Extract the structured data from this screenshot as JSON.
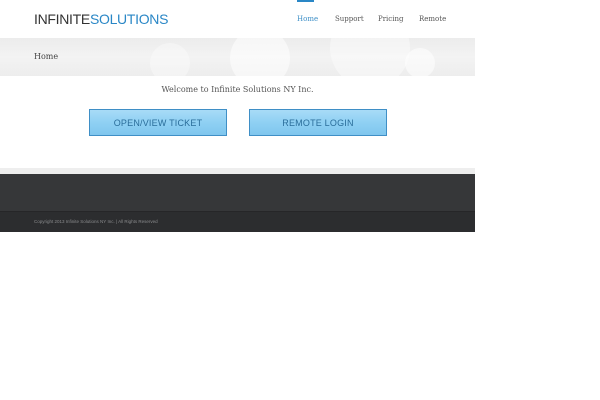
{
  "header": {
    "logo_part1": "INFINITE",
    "logo_part2": "SOLUTIONS",
    "nav": [
      {
        "label": "Home",
        "active": true
      },
      {
        "label": "Support",
        "active": false
      },
      {
        "label": "Pricing",
        "active": false
      },
      {
        "label": "Remote",
        "active": false
      }
    ],
    "colors": {
      "accent": "#2a87c6"
    }
  },
  "breadcrumb": {
    "current": "Home"
  },
  "main": {
    "welcome": "Welcome to Infinite Solutions NY Inc.",
    "buttons": {
      "open_ticket": "OPEN/VIEW TICKET",
      "remote_login": "REMOTE LOGIN"
    }
  },
  "footer": {
    "copyright": "Copyright 2013 Infinite Solutions NY Inc. | All Rights Reserved"
  }
}
